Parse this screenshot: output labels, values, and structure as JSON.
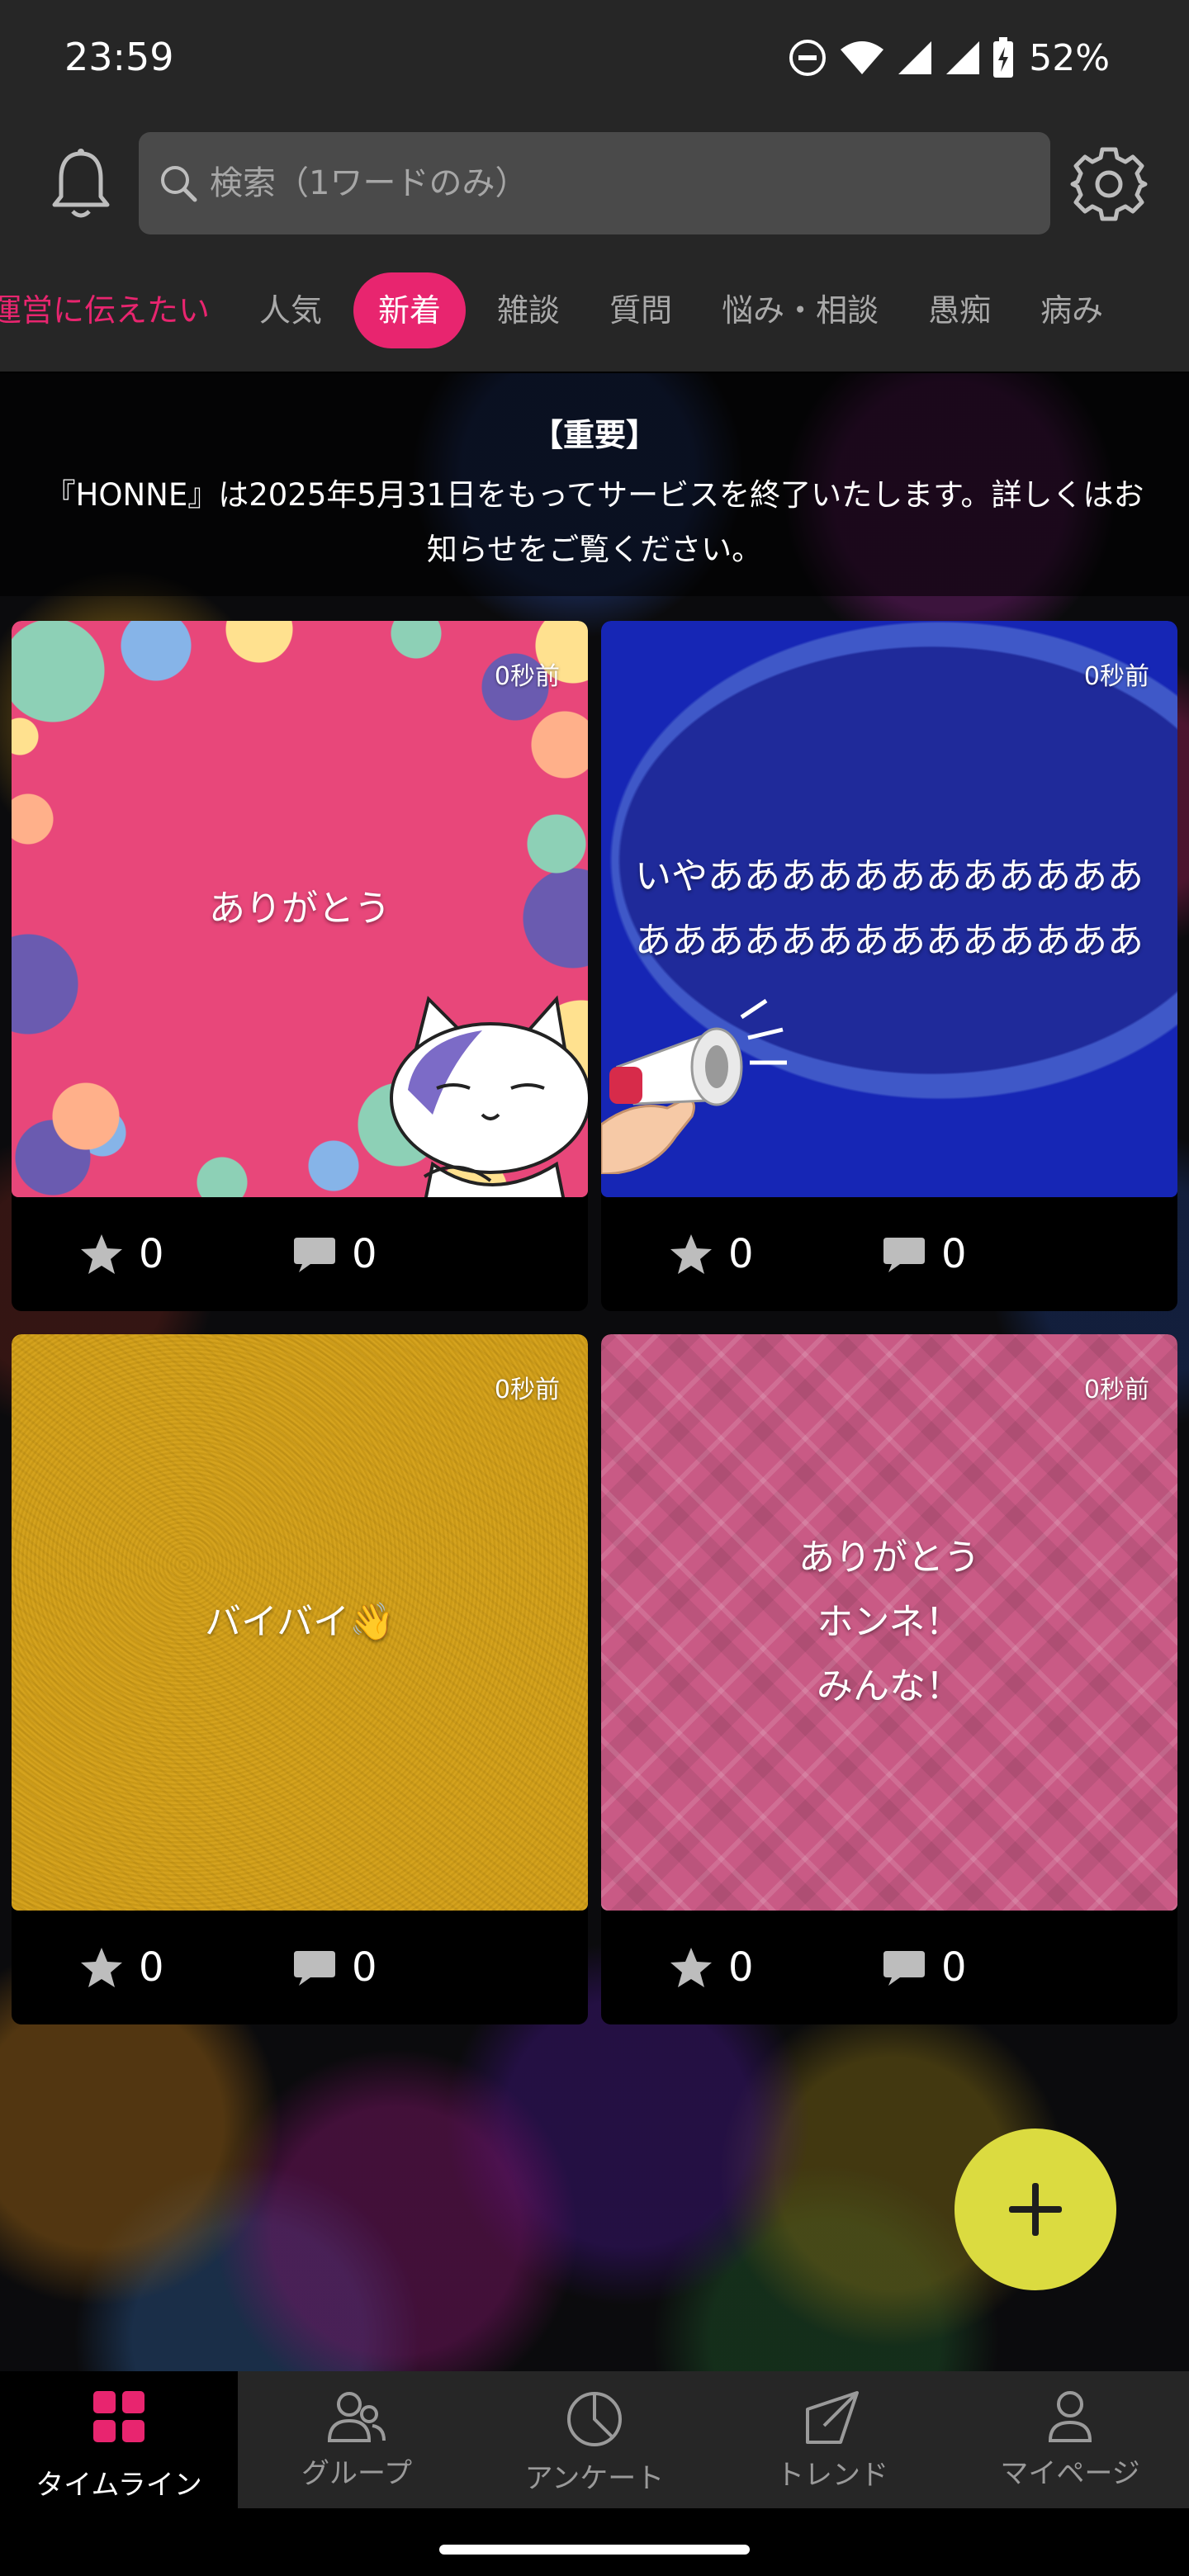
{
  "status_bar": {
    "time": "23:59",
    "battery": "52%"
  },
  "header": {
    "search_placeholder": "検索（1ワードのみ）"
  },
  "tabs": [
    {
      "label": "運営に伝えたい"
    },
    {
      "label": "人気"
    },
    {
      "label": "新着"
    },
    {
      "label": "雑談"
    },
    {
      "label": "質問"
    },
    {
      "label": "悩み・相談"
    },
    {
      "label": "愚痴"
    },
    {
      "label": "病み"
    }
  ],
  "active_tab": "新着",
  "notice": {
    "title": "【重要】",
    "body": "『HONNE』は2025年5月31日をもってサービスを終了いたします。詳しくはお知らせをご覧ください。"
  },
  "posts": [
    {
      "time": "0秒前",
      "text": "ありがとう",
      "stars": "0",
      "comments": "0",
      "background": "pink-dots-cat"
    },
    {
      "time": "0秒前",
      "text": "いやああああああああああああああああああああああああああ",
      "stars": "0",
      "comments": "0",
      "background": "blue-megaphone"
    },
    {
      "time": "0秒前",
      "text": "バイバイ👋",
      "stars": "0",
      "comments": "0",
      "background": "gold-leather"
    },
    {
      "time": "0秒前",
      "text": "ありがとう\nホンネ！\nみんな！",
      "stars": "0",
      "comments": "0",
      "background": "pink-plaid"
    }
  ],
  "bottom_nav": [
    {
      "label": "タイムライン",
      "icon": "grid-icon",
      "active": true
    },
    {
      "label": "グループ",
      "icon": "group-icon",
      "active": false
    },
    {
      "label": "アンケート",
      "icon": "pie-chart-icon",
      "active": false
    },
    {
      "label": "トレンド",
      "icon": "trend-arrow-icon",
      "active": false
    },
    {
      "label": "マイページ",
      "icon": "person-icon",
      "active": false
    }
  ],
  "colors": {
    "accent": "#e8256f",
    "fab": "#dbdb40",
    "bar": "#262626"
  }
}
